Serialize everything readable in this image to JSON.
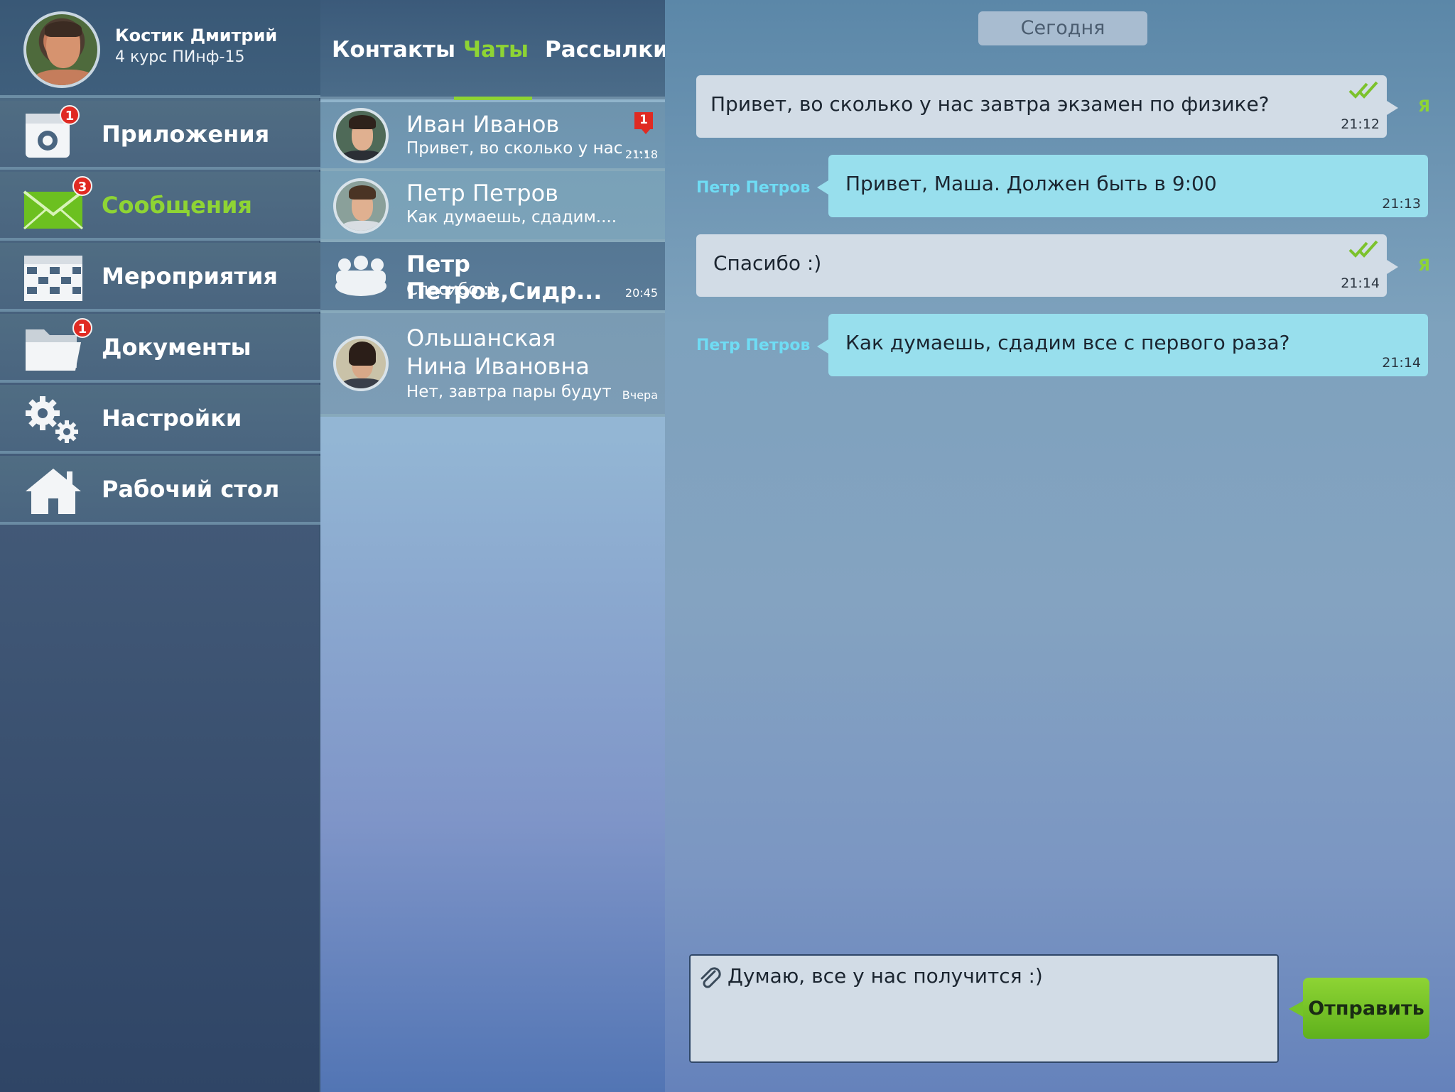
{
  "profile": {
    "name": "Костик Дмитрий",
    "subtitle": "4 курс ПИнф-15"
  },
  "menu": [
    {
      "label": "Приложения",
      "icon": "apps-icon",
      "badge": "1"
    },
    {
      "label": "Сообщения",
      "icon": "mail-icon",
      "badge": "3",
      "active": true
    },
    {
      "label": "Мероприятия",
      "icon": "calendar-icon"
    },
    {
      "label": "Документы",
      "icon": "folder-icon",
      "badge": "1"
    },
    {
      "label": "Настройки",
      "icon": "gears-icon"
    },
    {
      "label": "Рабочий стол",
      "icon": "home-icon"
    }
  ],
  "tabs": [
    {
      "label": "Контакты"
    },
    {
      "label": "Чаты",
      "active": true
    },
    {
      "label": "Рассылки"
    }
  ],
  "chats": [
    {
      "name": "Иван Иванов",
      "preview": "Привет, во сколько у нас ....",
      "time": "21:18",
      "unread": "1"
    },
    {
      "name": "Петр Петров",
      "preview": "Как думаешь, сдадим....",
      "time": ""
    },
    {
      "name": "Петр Петров,Сидр...",
      "preview": "Спасибо :)",
      "time": "20:45",
      "group": true
    },
    {
      "name_line1": "Ольшанская",
      "name_line2": "Нина Ивановна",
      "preview": "Нет, завтра пары будут",
      "time": "Вчера"
    }
  ],
  "conversation": {
    "date_label": "Сегодня",
    "me_label": "Я",
    "messages": [
      {
        "from": "me",
        "text": "Привет, во сколько у нас завтра экзамен по физике?",
        "time": "21:12",
        "read": true
      },
      {
        "from": "them",
        "sender": "Петр Петров",
        "text": "Привет, Маша. Должен быть в 9:00",
        "time": "21:13"
      },
      {
        "from": "me",
        "text": "Спасибо :)",
        "time": "21:14",
        "read": true
      },
      {
        "from": "them",
        "sender": "Петр Петров",
        "text": "Как думаешь, сдадим все с первого раза?",
        "time": "21:14"
      }
    ]
  },
  "composer": {
    "value": "Думаю, все у нас получится :)",
    "send_label": "Отправить"
  },
  "colors": {
    "accent": "#8ed434",
    "badge": "#e02a22",
    "incoming_bubble": "#98dfed",
    "outgoing_bubble": "#d2dce6"
  }
}
